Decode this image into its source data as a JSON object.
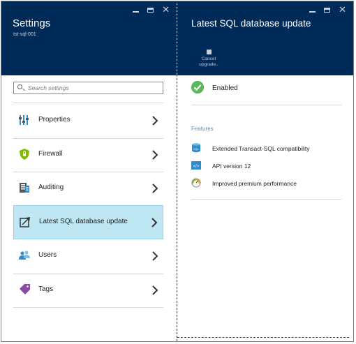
{
  "left_blade": {
    "title": "Settings",
    "subtitle": "tst-sql-001",
    "search": {
      "placeholder": "Search settings",
      "value": ""
    },
    "items": [
      {
        "label": "Properties",
        "icon": "properties-icon",
        "selected": false
      },
      {
        "label": "Firewall",
        "icon": "shield-icon",
        "selected": false
      },
      {
        "label": "Auditing",
        "icon": "auditing-icon",
        "selected": false
      },
      {
        "label": "Latest SQL database update",
        "icon": "update-icon",
        "selected": true
      },
      {
        "label": "Users",
        "icon": "users-icon",
        "selected": false
      },
      {
        "label": "Tags",
        "icon": "tag-icon",
        "selected": false
      }
    ]
  },
  "right_blade": {
    "title": "Latest SQL database update",
    "command": {
      "label_line1": "Cancel",
      "label_line2": "upgrade..",
      "icon": "stop-icon"
    },
    "status": {
      "text": "Enabled",
      "icon": "checkmark-icon",
      "color": "#5cb85c"
    },
    "features_label": "Features",
    "features": [
      {
        "label": "Extended Transact-SQL compatibility",
        "icon": "sql-icon"
      },
      {
        "label": "API version 12",
        "icon": "api-icon"
      },
      {
        "label": "Improved premium performance",
        "icon": "gauge-icon"
      }
    ]
  },
  "colors": {
    "header_bg": "#002b58",
    "selected_bg": "#bfe6f3",
    "accent_blue": "#2e8bcc",
    "success_green": "#5cb85c"
  }
}
